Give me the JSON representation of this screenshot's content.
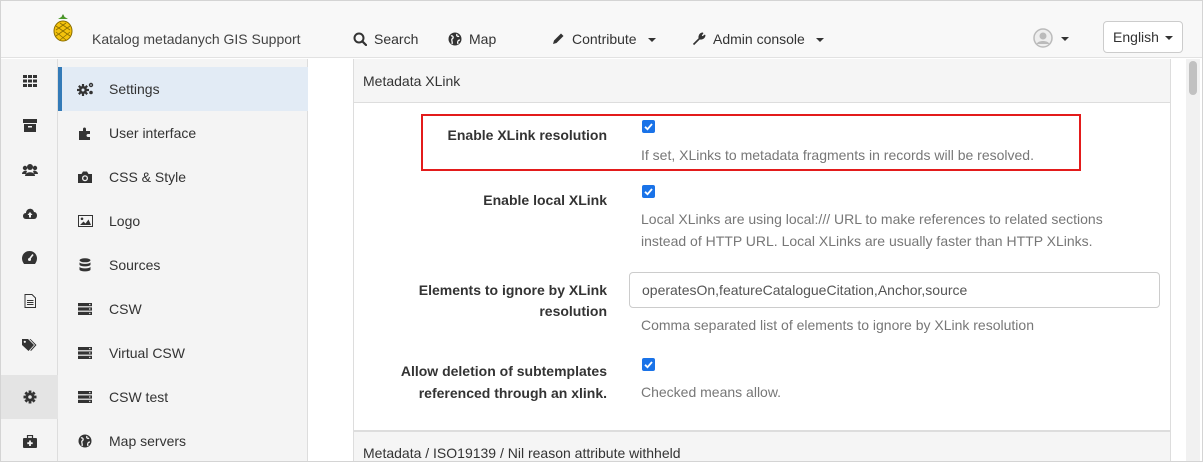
{
  "navbar": {
    "brand": "Katalog metadanych GIS Support",
    "items": [
      {
        "label": "Search",
        "icon": "search-icon"
      },
      {
        "label": "Map",
        "icon": "globe-icon"
      },
      {
        "label": "Contribute",
        "icon": "pencil-icon"
      },
      {
        "label": "Admin console",
        "icon": "wrench-icon"
      }
    ],
    "language": "English"
  },
  "settings_menu": {
    "items": [
      {
        "label": "Settings",
        "icon": "cogs-icon",
        "active": true
      },
      {
        "label": "User interface",
        "icon": "puzzle-icon"
      },
      {
        "label": "CSS & Style",
        "icon": "camera-icon"
      },
      {
        "label": "Logo",
        "icon": "picture-icon"
      },
      {
        "label": "Sources",
        "icon": "database-icon"
      },
      {
        "label": "CSW",
        "icon": "server-icon"
      },
      {
        "label": "Virtual CSW",
        "icon": "server-icon"
      },
      {
        "label": "CSW test",
        "icon": "server-icon"
      },
      {
        "label": "Map servers",
        "icon": "globe-icon"
      }
    ]
  },
  "icon_rail": [
    "grid-icon",
    "archive-icon",
    "users-icon",
    "cloud-upload-icon",
    "dashboard-icon",
    "file-icon",
    "tags-icon",
    "gear-icon",
    "medkit-icon"
  ],
  "panel": {
    "title": "Metadata XLink",
    "rows": [
      {
        "label": "Enable XLink resolution",
        "checked": true,
        "help": "If set, XLinks to metadata fragments in records will be resolved."
      },
      {
        "label": "Enable local XLink",
        "checked": true,
        "help_line1": "Local XLinks are using local:/// URL to make references to related sections",
        "help_line2": "instead of HTTP URL. Local XLinks are usually faster than HTTP XLinks."
      },
      {
        "label_line1": "Elements to ignore by XLink",
        "label_line2": "resolution",
        "value": "operatesOn,featureCatalogueCitation,Anchor,source",
        "help": "Comma separated list of elements to ignore by XLink resolution"
      },
      {
        "label_line1": "Allow deletion of subtemplates",
        "label_line2": "referenced through an xlink.",
        "checked": true,
        "help": "Checked means allow."
      }
    ]
  },
  "next_panel": {
    "title": "Metadata / ISO19139 / Nil reason attribute withheld"
  },
  "colors": {
    "accent": "#337ab7",
    "checkbox": "#1a73e8",
    "highlight": "#e31b1b"
  }
}
